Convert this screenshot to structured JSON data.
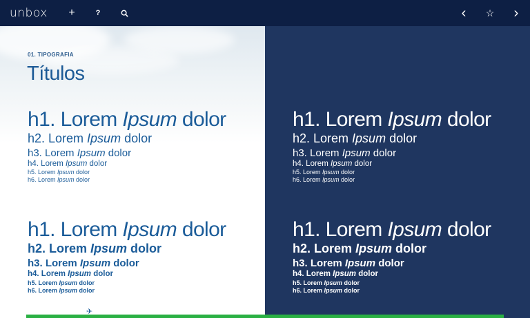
{
  "app": {
    "logo": "unbox"
  },
  "toolbar": {
    "add_icon": "+",
    "help_icon": "?",
    "search_icon": "search",
    "prev_icon": "‹",
    "favorite_icon": "☆",
    "next_icon": "›"
  },
  "section": {
    "label": "01. TIPOGRAFIA",
    "title": "Títulos"
  },
  "samples": [
    {
      "prefix": "h1. Lorem ",
      "italic": "Ipsum",
      "suffix": " dolor"
    },
    {
      "prefix": "h2. Lorem ",
      "italic": "Ipsum",
      "suffix": " dolor"
    },
    {
      "prefix": "h3. Lorem ",
      "italic": "Ipsum",
      "suffix": " dolor"
    },
    {
      "prefix": "h4. Lorem ",
      "italic": "Ipsum",
      "suffix": " dolor"
    },
    {
      "prefix": "h5. Lorem ",
      "italic": "Ipsum",
      "suffix": " dolor"
    },
    {
      "prefix": "h6. Lorem ",
      "italic": "Ipsum",
      "suffix": " dolor"
    }
  ],
  "colors": {
    "topbar": "#0d1f44",
    "dark_panel": "#1f3660",
    "heading_blue": "#1b5c99",
    "progress_green": "#2ab043"
  },
  "progress": {
    "value": 0.9
  }
}
